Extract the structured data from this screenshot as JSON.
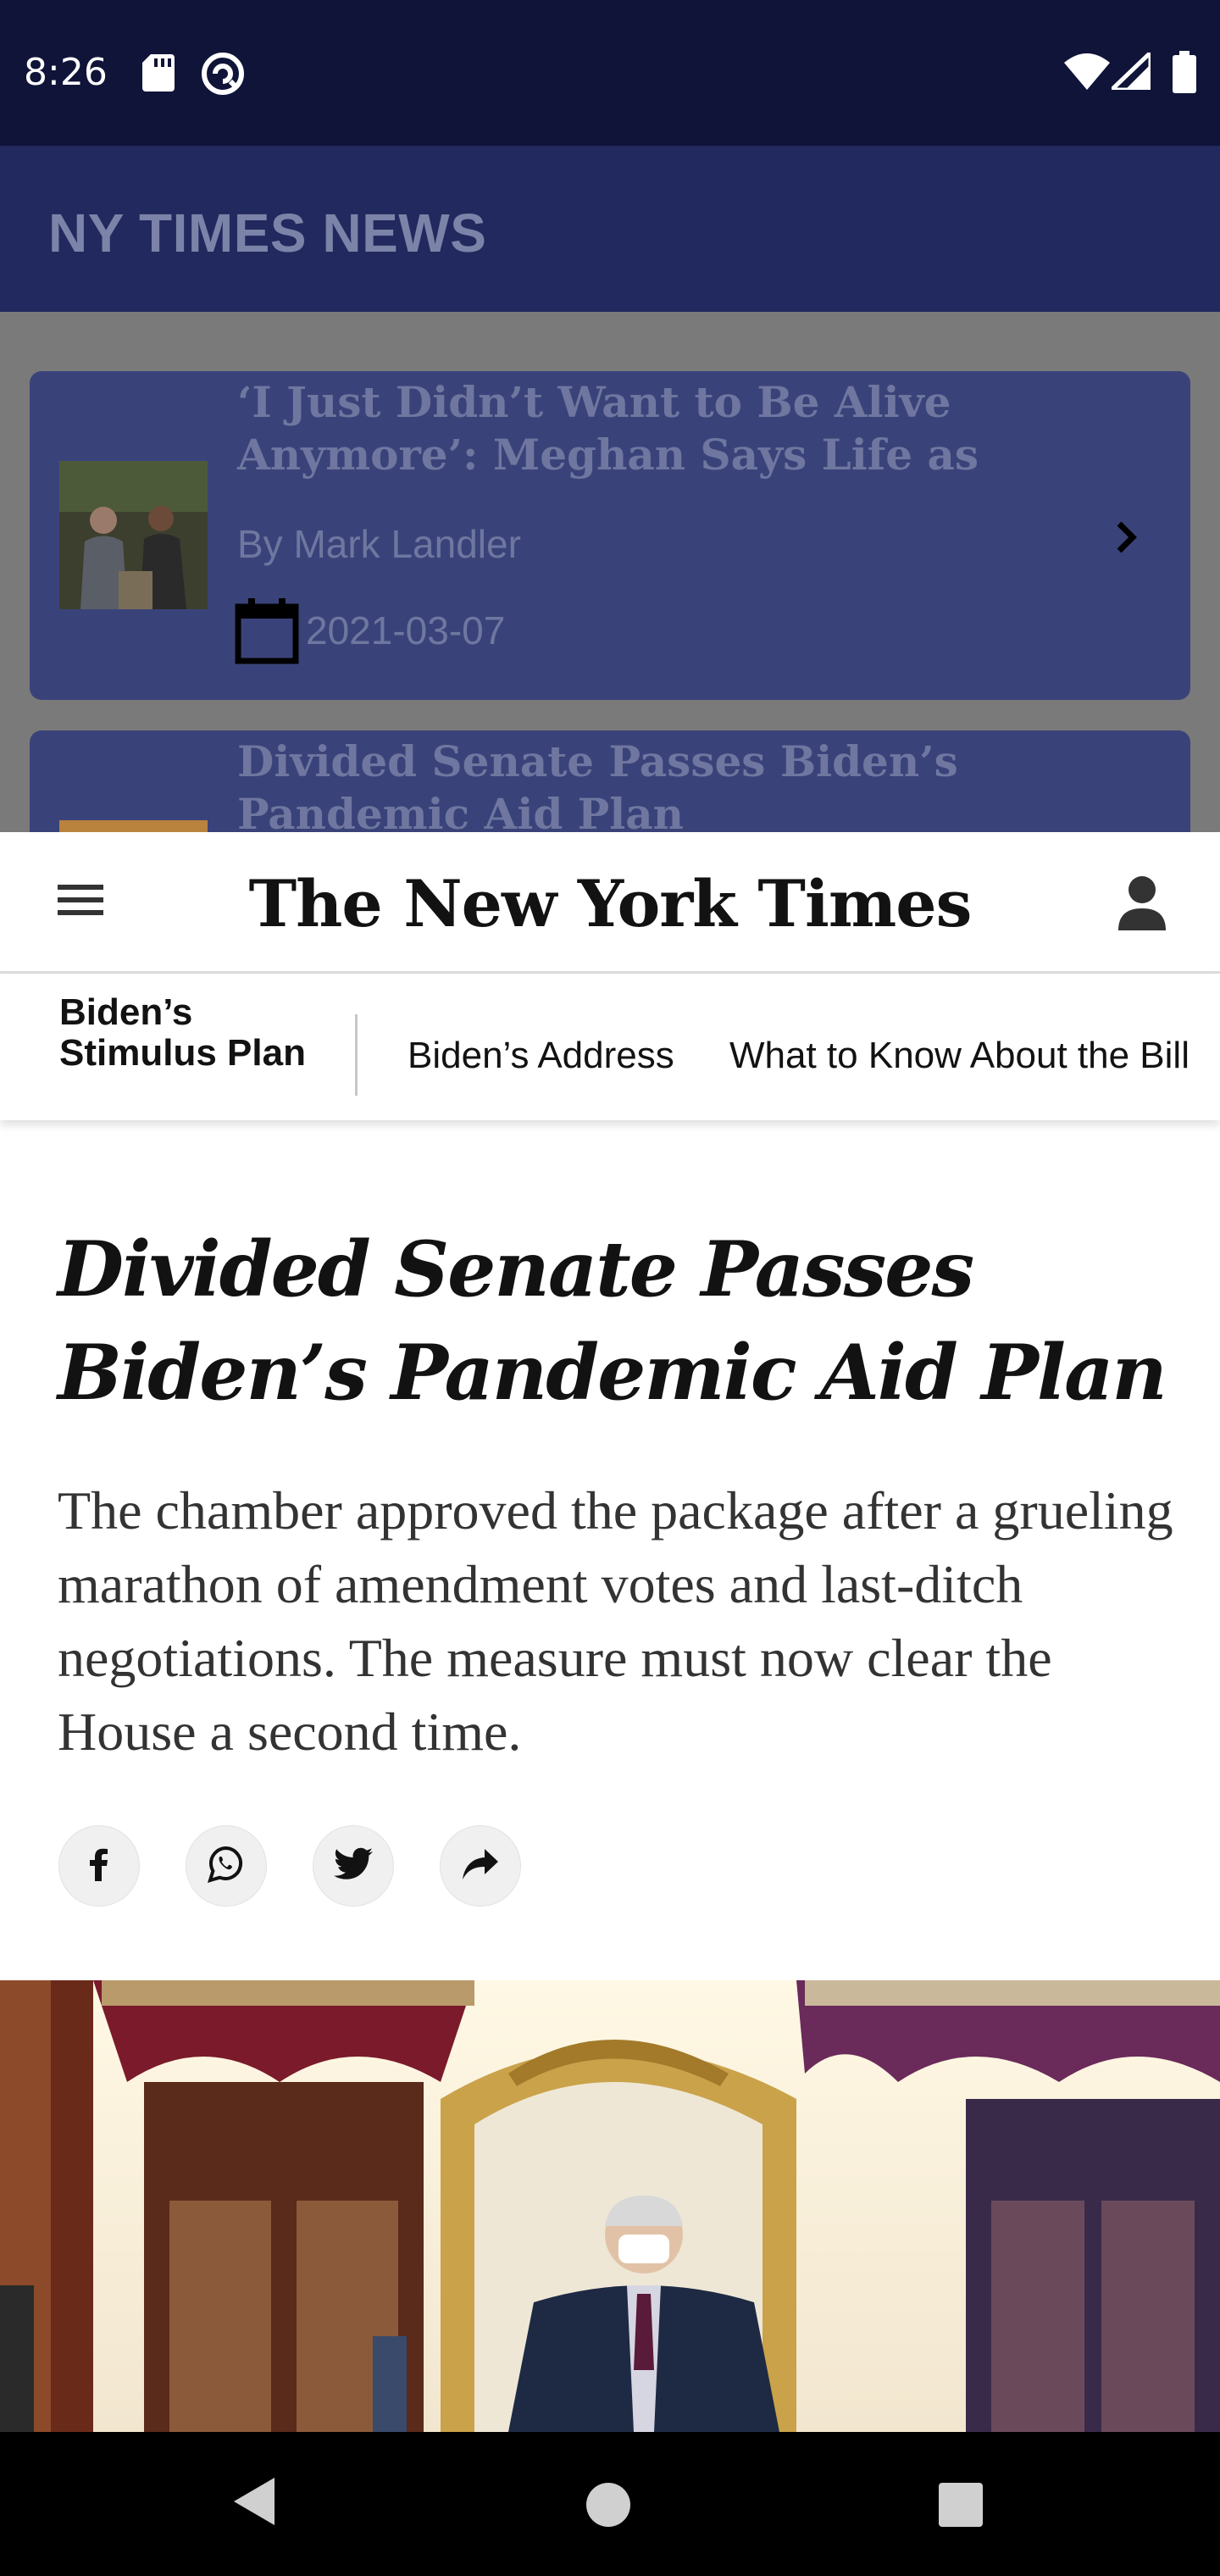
{
  "status_bar": {
    "time": "8:26",
    "icons": [
      "sd-card-icon",
      "notification-icon",
      "wifi-icon",
      "signal-icon",
      "battery-icon"
    ]
  },
  "app_bar": {
    "title": "NY TIMES NEWS"
  },
  "news_list": [
    {
      "title": "‘I Just Didn’t Want to Be Alive Anymore’: Meghan Says Life as",
      "author": "By Mark Landler",
      "date": "2021-03-07"
    },
    {
      "title": "Divided Senate Passes Biden’s Pandemic Aid Plan"
    }
  ],
  "nyt_header": {
    "logo": "The New York Times"
  },
  "topic_nav": {
    "label": "Biden’s Stimulus Plan",
    "links": [
      "Biden’s Address",
      "What to Know About the Bill"
    ]
  },
  "article": {
    "headline": "Divided Senate Passes Biden’s Pandemic Aid Plan",
    "summary": "The chamber approved the package after a grueling marathon of amendment votes and last-ditch negotiations. The measure must now clear the House a second time.",
    "share_buttons": [
      "facebook-icon",
      "whatsapp-icon",
      "twitter-icon",
      "share-icon"
    ]
  },
  "colors": {
    "status_bar": "#0f1438",
    "app_bar": "#22295e",
    "card": "#3a4379",
    "text_primary": "#121212"
  }
}
